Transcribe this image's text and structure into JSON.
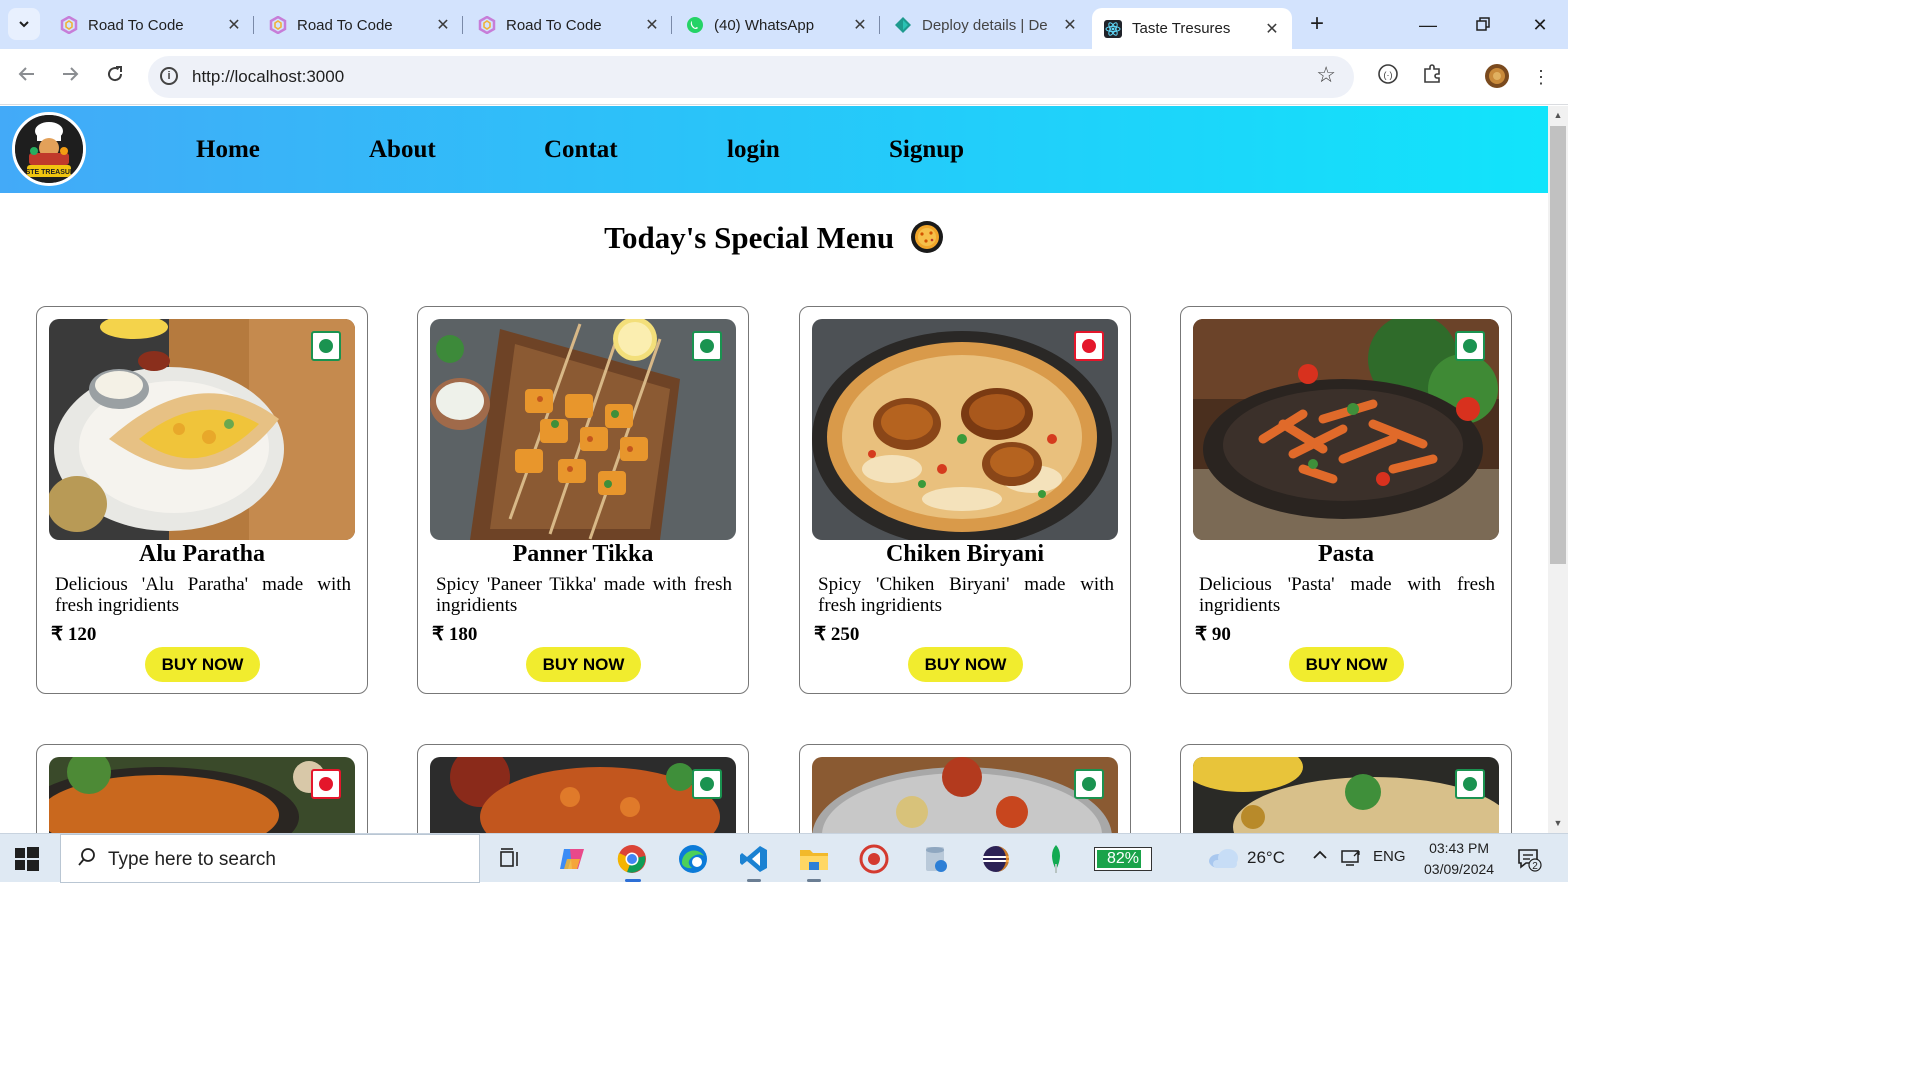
{
  "browser": {
    "tabs": [
      {
        "title": "Road To Code",
        "icon": "road-to-code-icon"
      },
      {
        "title": "Road To Code",
        "icon": "road-to-code-icon"
      },
      {
        "title": "Road To Code",
        "icon": "road-to-code-icon"
      },
      {
        "title": "(40) WhatsApp",
        "icon": "whatsapp-icon"
      },
      {
        "title": "Deploy details | De",
        "icon": "netlify-icon"
      },
      {
        "title": "Taste Tresures",
        "icon": "react-icon"
      }
    ],
    "active_tab_index": 5,
    "url": "http://localhost:3000"
  },
  "site": {
    "logo_text": "TASTE TREASUIES",
    "nav": [
      {
        "label": "Home"
      },
      {
        "label": "About"
      },
      {
        "label": "Contat"
      },
      {
        "label": "login"
      },
      {
        "label": "Signup"
      }
    ],
    "menu_title": "Today's Special Menu",
    "buy_label": "BUY NOW",
    "currency": "₹",
    "cards": [
      {
        "name": "Alu Paratha",
        "description": "Delicious 'Alu Paratha' made with fresh ingridients",
        "price": "120",
        "type": "veg"
      },
      {
        "name": "Panner Tikka",
        "description": "Spicy 'Paneer Tikka' made with fresh ingridients",
        "price": "180",
        "type": "veg"
      },
      {
        "name": "Chiken Biryani",
        "description": "Spicy 'Chiken Biryani' made with fresh ingridients",
        "price": "250",
        "type": "non-veg"
      },
      {
        "name": "Pasta",
        "description": "Delicious 'Pasta' made with fresh ingridients",
        "price": "90",
        "type": "veg"
      }
    ],
    "second_row_types": [
      "non-veg",
      "veg",
      "veg",
      "veg"
    ]
  },
  "taskbar": {
    "search_placeholder": "Type here to search",
    "battery_text": "82%",
    "battery_level": 0.82,
    "temperature": "26°C",
    "language": "ENG",
    "time": "03:43 PM",
    "date": "03/09/2024",
    "notification_count": "2"
  },
  "colors": {
    "header_gradient_start": "#43aaf8",
    "header_gradient_end": "#11e4fb",
    "buy_button": "#f1ec2e",
    "veg_green": "#1a9350",
    "nonveg_red": "#e4162b"
  }
}
